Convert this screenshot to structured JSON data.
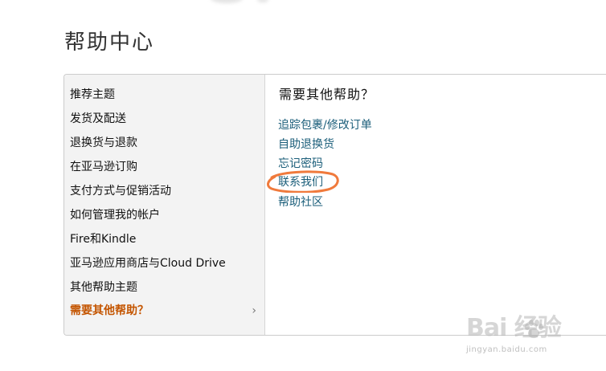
{
  "page": {
    "title": "帮助中心"
  },
  "left_nav": {
    "items": [
      {
        "label": "推荐主题"
      },
      {
        "label": "发货及配送"
      },
      {
        "label": "退换货与退款"
      },
      {
        "label": "在亚马逊订购"
      },
      {
        "label": "支付方式与促销活动"
      },
      {
        "label": "如何管理我的帐户"
      },
      {
        "label": "Fire和Kindle"
      },
      {
        "label": "亚马逊应用商店与Cloud Drive"
      },
      {
        "label": "其他帮助主题"
      }
    ],
    "active_item": {
      "label": "需要其他帮助？",
      "chevron": "›"
    },
    "active_color": "#c45500"
  },
  "right_pane": {
    "heading": "需要其他帮助？",
    "links": [
      {
        "label": "追踪包裹/修改订单"
      },
      {
        "label": "自助退换货"
      },
      {
        "label": "忘记密码"
      },
      {
        "label": "联系我们",
        "highlighted": true
      },
      {
        "label": "帮助社区"
      }
    ],
    "link_color": "#1b5e7a",
    "annotation_color": "#f07a3c"
  },
  "watermark": {
    "brand": "Bai  经验",
    "sub": "jingyan.baidu.com"
  }
}
